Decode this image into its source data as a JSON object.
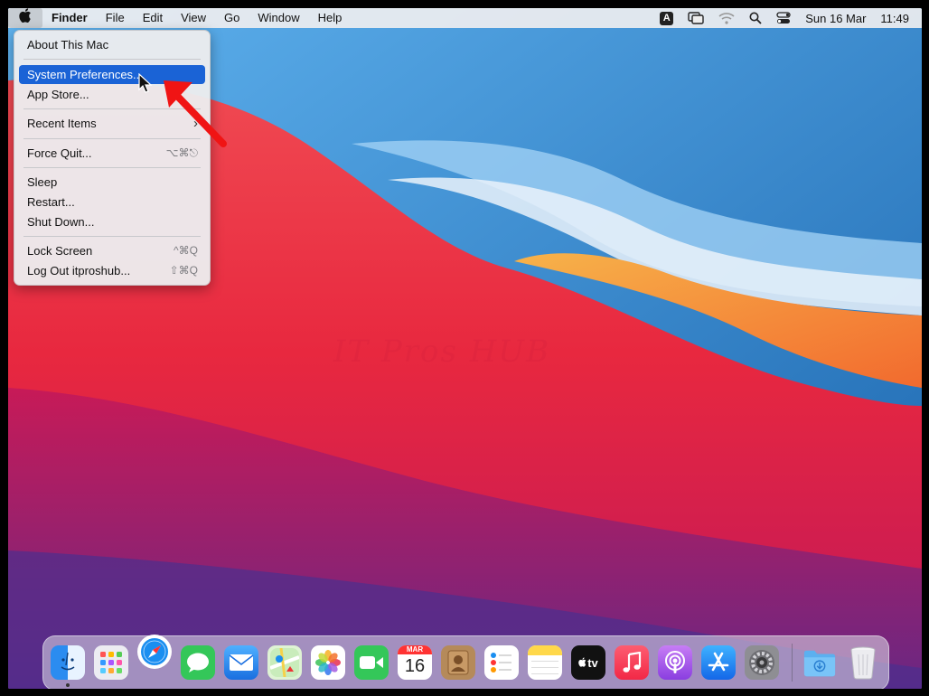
{
  "menubar": {
    "apple_icon": "apple-logo-icon",
    "app_name": "Finder",
    "menus": [
      "File",
      "Edit",
      "View",
      "Go",
      "Window",
      "Help"
    ],
    "status_icons": [
      "keyboard-input-icon",
      "screen-mirroring-icon",
      "wifi-icon",
      "spotlight-search-icon",
      "control-center-icon"
    ],
    "input_source": "A",
    "date": "Sun 16 Mar",
    "time": "11:49"
  },
  "apple_menu": {
    "items": [
      {
        "label": "About This Mac",
        "shortcut": ""
      },
      {
        "label": "System Preferences...",
        "shortcut": "",
        "highlighted": true
      },
      {
        "label": "App Store...",
        "shortcut": ""
      },
      {
        "label": "Recent Items",
        "shortcut": "›"
      },
      {
        "label": "Force Quit...",
        "shortcut": "⌥⌘⎋"
      },
      {
        "label": "Sleep",
        "shortcut": ""
      },
      {
        "label": "Restart...",
        "shortcut": ""
      },
      {
        "label": "Shut Down...",
        "shortcut": ""
      },
      {
        "label": "Lock Screen",
        "shortcut": "^⌘Q"
      },
      {
        "label": "Log Out itproshub...",
        "shortcut": "⇧⌘Q"
      }
    ]
  },
  "watermark": "IT Pros HUB",
  "dock": {
    "apps": [
      {
        "name": "Finder",
        "icon": "finder-icon",
        "color": "#2b8cf0",
        "running": true
      },
      {
        "name": "Launchpad",
        "icon": "launchpad-icon",
        "color": "#e9e9ef",
        "running": false
      },
      {
        "name": "Safari",
        "icon": "safari-icon",
        "color": "#1a8ef0",
        "running": false
      },
      {
        "name": "Messages",
        "icon": "messages-icon",
        "color": "#34c759",
        "running": false
      },
      {
        "name": "Mail",
        "icon": "mail-icon",
        "color": "#2a8cf2",
        "running": false
      },
      {
        "name": "Maps",
        "icon": "maps-icon",
        "color": "#7ccb5a",
        "running": false
      },
      {
        "name": "Photos",
        "icon": "photos-icon",
        "color": "#ffffff",
        "running": false
      },
      {
        "name": "FaceTime",
        "icon": "facetime-icon",
        "color": "#34c759",
        "running": false
      },
      {
        "name": "Calendar",
        "icon": "calendar-icon",
        "color": "#ffffff",
        "running": false
      },
      {
        "name": "Contacts",
        "icon": "contacts-icon",
        "color": "#b58a5a",
        "running": false
      },
      {
        "name": "Reminders",
        "icon": "reminders-icon",
        "color": "#ffffff",
        "running": false
      },
      {
        "name": "Notes",
        "icon": "notes-icon",
        "color": "#ffd84a",
        "running": false
      },
      {
        "name": "TV",
        "icon": "apple-tv-icon",
        "color": "#111111",
        "running": false
      },
      {
        "name": "Music",
        "icon": "music-icon",
        "color": "#fb3c55",
        "running": false
      },
      {
        "name": "Podcasts",
        "icon": "podcasts-icon",
        "color": "#9a4ee6",
        "running": false
      },
      {
        "name": "App Store",
        "icon": "app-store-icon",
        "color": "#1e90f5",
        "running": false
      },
      {
        "name": "System Preferences",
        "icon": "system-preferences-icon",
        "color": "#8e8e93",
        "running": false
      },
      {
        "name": "Downloads",
        "icon": "downloads-folder-icon",
        "color": "#6cb8f0",
        "running": false
      },
      {
        "name": "Trash",
        "icon": "trash-icon",
        "color": "#e8e8ec",
        "running": false
      }
    ],
    "calendar_month": "MAR",
    "calendar_day": "16",
    "tv_label": "tv"
  }
}
